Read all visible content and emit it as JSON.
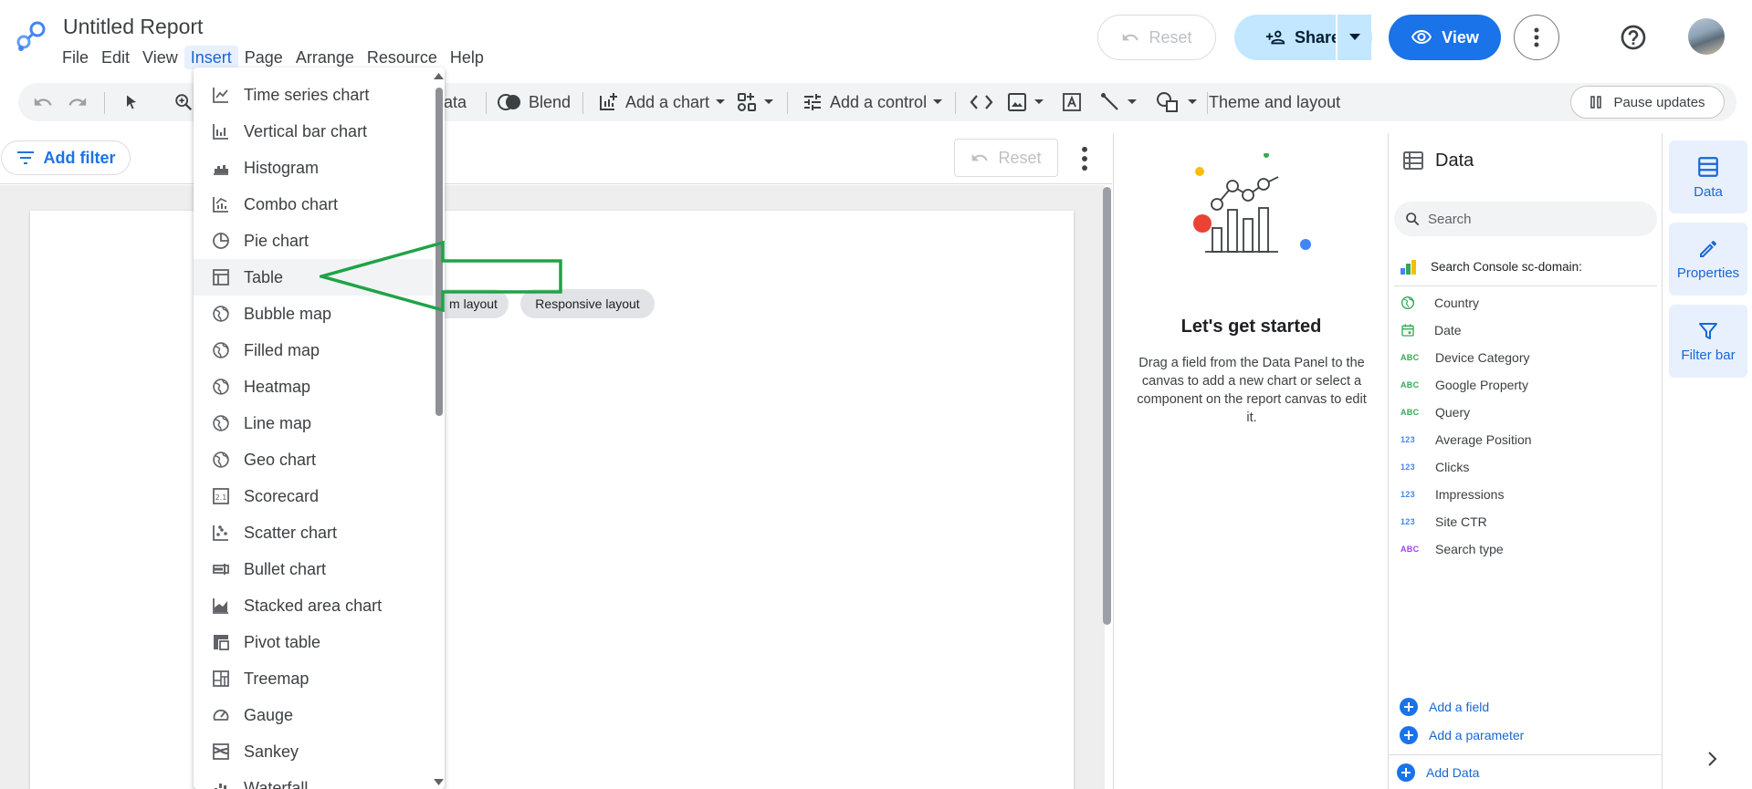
{
  "header": {
    "title": "Untitled Report",
    "menu": [
      "File",
      "Edit",
      "View",
      "Insert",
      "Page",
      "Arrange",
      "Resource",
      "Help"
    ],
    "active_menu_index": 3,
    "reset_label": "Reset",
    "share_label": "Share",
    "view_label": "View"
  },
  "toolbar": {
    "data_label_partial": "ata",
    "blend_label": "Blend",
    "add_chart_label": "Add a chart",
    "add_control_label": "Add a control",
    "theme_label": "Theme and layout",
    "pause_label": "Pause updates"
  },
  "filter_bar": {
    "add_filter_label": "Add filter",
    "reset_label": "Reset"
  },
  "canvas": {
    "layout_chip_partial": "m layout",
    "responsive_chip": "Responsive layout"
  },
  "insert_menu": {
    "items": [
      {
        "label": "Time series chart",
        "icon": "time-series-icon"
      },
      {
        "label": "Vertical bar chart",
        "icon": "bar-chart-icon"
      },
      {
        "label": "Histogram",
        "icon": "histogram-icon"
      },
      {
        "label": "Combo chart",
        "icon": "combo-chart-icon"
      },
      {
        "label": "Pie chart",
        "icon": "pie-chart-icon"
      },
      {
        "label": "Table",
        "icon": "table-icon"
      },
      {
        "label": "Bubble map",
        "icon": "globe-icon"
      },
      {
        "label": "Filled map",
        "icon": "globe-icon"
      },
      {
        "label": "Heatmap",
        "icon": "globe-icon"
      },
      {
        "label": "Line map",
        "icon": "globe-icon"
      },
      {
        "label": "Geo chart",
        "icon": "globe-icon"
      },
      {
        "label": "Scorecard",
        "icon": "scorecard-icon"
      },
      {
        "label": "Scatter chart",
        "icon": "scatter-icon"
      },
      {
        "label": "Bullet chart",
        "icon": "bullet-chart-icon"
      },
      {
        "label": "Stacked area chart",
        "icon": "area-chart-icon"
      },
      {
        "label": "Pivot table",
        "icon": "pivot-table-icon"
      },
      {
        "label": "Treemap",
        "icon": "treemap-icon"
      },
      {
        "label": "Gauge",
        "icon": "gauge-icon"
      },
      {
        "label": "Sankey",
        "icon": "sankey-icon"
      },
      {
        "label": "Waterfall",
        "icon": "waterfall-icon"
      }
    ],
    "highlighted_index": 5
  },
  "get_started": {
    "title": "Let's get started",
    "body": "Drag a field from the Data Panel to the canvas to add a new chart or select a component on the report canvas to edit it."
  },
  "data_panel": {
    "title": "Data",
    "search_placeholder": "Search",
    "data_source": "Search Console sc-domain:",
    "fields": [
      {
        "type": "geo",
        "name": "Country"
      },
      {
        "type": "date",
        "name": "Date"
      },
      {
        "type": "ABC",
        "name": "Device Category"
      },
      {
        "type": "ABC",
        "name": "Google Property"
      },
      {
        "type": "ABC",
        "name": "Query"
      },
      {
        "type": "123",
        "name": "Average Position"
      },
      {
        "type": "123",
        "name": "Clicks"
      },
      {
        "type": "123",
        "name": "Impressions"
      },
      {
        "type": "123",
        "name": "Site CTR"
      },
      {
        "type": "ABC",
        "name": "Search type"
      }
    ],
    "add_field_label": "Add a field",
    "add_parameter_label": "Add a parameter",
    "add_data_label": "Add Data"
  },
  "right_rail": {
    "data_label": "Data",
    "properties_label": "Properties",
    "filter_bar_label": "Filter bar"
  },
  "colors": {
    "accent_blue": "#1a73e8",
    "share_bg": "#c2e7ff",
    "annotation_arrow": "#1fa346",
    "dimension_green": "#34a853",
    "metric_blue": "#4285f4",
    "abc_purple": "#a142f4"
  }
}
